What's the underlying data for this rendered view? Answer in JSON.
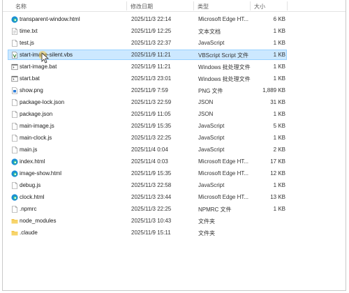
{
  "columns": {
    "name": "名称",
    "date": "修改日期",
    "type": "类型",
    "size": "大小"
  },
  "files": [
    {
      "name": "transparent-window.html",
      "date": "2025/11/3 22:14",
      "type": "Microsoft Edge HT...",
      "size": "6 KB",
      "icon": "edge-html-icon"
    },
    {
      "name": "time.txt",
      "date": "2025/11/9 12:25",
      "type": "文本文档",
      "size": "1 KB",
      "icon": "text-file-icon"
    },
    {
      "name": "test.js",
      "date": "2025/11/3 22:37",
      "type": "JavaScript",
      "size": "1 KB",
      "icon": "js-file-icon"
    },
    {
      "name": "start-image-silent.vbs",
      "date": "2025/11/9 11:21",
      "type": "VBScript Script 文件",
      "size": "1 KB",
      "icon": "vbs-file-icon",
      "selected": true
    },
    {
      "name": "start-image.bat",
      "date": "2025/11/9 11:21",
      "type": "Windows 批处理文件",
      "size": "1 KB",
      "icon": "bat-file-icon"
    },
    {
      "name": "start.bat",
      "date": "2025/11/3 23:01",
      "type": "Windows 批处理文件",
      "size": "1 KB",
      "icon": "bat-file-icon"
    },
    {
      "name": "show.png",
      "date": "2025/11/9 7:59",
      "type": "PNG 文件",
      "size": "1,889 KB",
      "icon": "png-file-icon"
    },
    {
      "name": "package-lock.json",
      "date": "2025/11/3 22:59",
      "type": "JSON",
      "size": "31 KB",
      "icon": "generic-file-icon"
    },
    {
      "name": "package.json",
      "date": "2025/11/9 11:05",
      "type": "JSON",
      "size": "1 KB",
      "icon": "generic-file-icon"
    },
    {
      "name": "main-image.js",
      "date": "2025/11/9 15:35",
      "type": "JavaScript",
      "size": "5 KB",
      "icon": "js-file-icon"
    },
    {
      "name": "main-clock.js",
      "date": "2025/11/3 22:25",
      "type": "JavaScript",
      "size": "1 KB",
      "icon": "js-file-icon"
    },
    {
      "name": "main.js",
      "date": "2025/11/4 0:04",
      "type": "JavaScript",
      "size": "2 KB",
      "icon": "js-file-icon"
    },
    {
      "name": "index.html",
      "date": "2025/11/4 0:03",
      "type": "Microsoft Edge HT...",
      "size": "17 KB",
      "icon": "edge-html-icon"
    },
    {
      "name": "image-show.html",
      "date": "2025/11/9 15:35",
      "type": "Microsoft Edge HT...",
      "size": "12 KB",
      "icon": "edge-html-icon"
    },
    {
      "name": "debug.js",
      "date": "2025/11/3 22:58",
      "type": "JavaScript",
      "size": "1 KB",
      "icon": "js-file-icon"
    },
    {
      "name": "clock.html",
      "date": "2025/11/3 23:44",
      "type": "Microsoft Edge HT...",
      "size": "13 KB",
      "icon": "edge-html-icon"
    },
    {
      "name": ".npmrc",
      "date": "2025/11/3 22:25",
      "type": "NPMRC 文件",
      "size": "1 KB",
      "icon": "generic-file-icon"
    },
    {
      "name": "node_modules",
      "date": "2025/11/3 10:43",
      "type": "文件夹",
      "size": "",
      "icon": "folder-icon"
    },
    {
      "name": ".claude",
      "date": "2025/11/9 15:11",
      "type": "文件夹",
      "size": "",
      "icon": "folder-icon"
    }
  ],
  "colors": {
    "selection_bg": "#cce8ff",
    "selection_border": "#99d1ff",
    "folder": "#f4c54a",
    "edge": "#1b8fd6"
  }
}
